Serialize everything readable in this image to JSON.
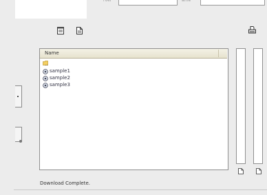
{
  "top": {
    "field1_label": "rver",
    "field2_label": "ame"
  },
  "toolbar": {
    "icons": [
      "notepad-icon",
      "document-icon",
      "printer-icon"
    ]
  },
  "file_list": {
    "column_header": "Name",
    "items": [
      {
        "label": "..",
        "icon": "folder-icon"
      },
      {
        "label": "sample1",
        "icon": "file-icon"
      },
      {
        "label": "sample2",
        "icon": "file-icon"
      },
      {
        "label": "sample3",
        "icon": "file-icon"
      }
    ]
  },
  "status": {
    "text": "Download Complete."
  },
  "colors": {
    "panel_border": "#8f8f8f",
    "header_bg": "#eae6d3",
    "background": "#ececec"
  }
}
